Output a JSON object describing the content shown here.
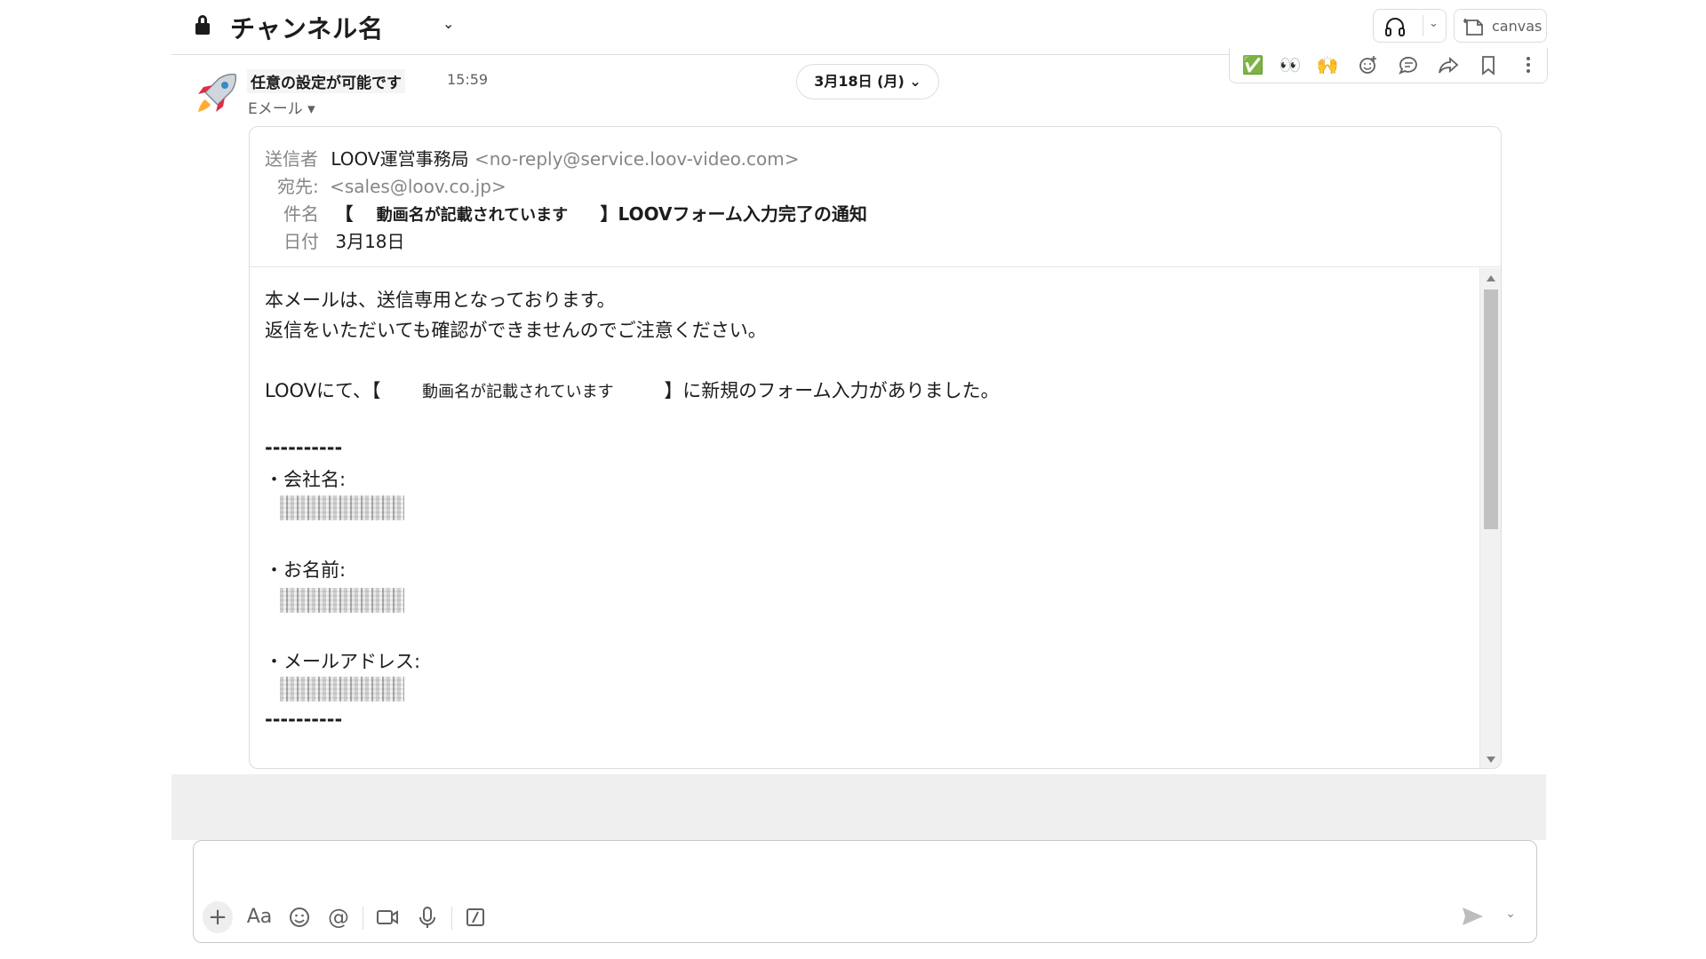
{
  "header": {
    "channel_name": "チャンネル名",
    "canvas_label": "canvas"
  },
  "message": {
    "sender_name": "任意の設定が可能です",
    "time": "15:59",
    "subtitle": "Eメール ▾",
    "date_pill": "3月18日 (月) ⌄",
    "reactions": [
      "✅",
      "👀",
      "🙌"
    ],
    "icons": [
      "headphone-icon",
      "canvas-icon",
      "lock-icon",
      "rocket-icon",
      "add-reaction-icon",
      "reply-thread-icon",
      "share-icon",
      "bookmark-icon",
      "more-icon",
      "plus-icon",
      "formatting-icon",
      "emoji-icon",
      "mention-icon",
      "video-icon",
      "microphone-icon",
      "slash-command-icon",
      "send-icon"
    ]
  },
  "email": {
    "from_label": "送信者",
    "from_name": "LOOV運営事務局",
    "from_address": "<no-reply@service.loov-video.com>",
    "to_label": "宛先:",
    "to_address": "<sales@loov.co.jp>",
    "subject_label": "件名",
    "subject_open": "【",
    "subject_video": "動画名が記載されています",
    "subject_close": "】LOOVフォーム入力完了の通知",
    "date_label": "日付",
    "date_value": "3月18日",
    "body": {
      "line1": "本メールは、送信専用となっております。",
      "line2": "返信をいただいても確認ができませんのでご注意ください。",
      "line3_prefix": "LOOVにて、【",
      "line3_video": "動画名が記載されています",
      "line3_suffix": "】に新規のフォーム入力がありました。",
      "divider": "----------",
      "company_label": "・会社名:",
      "name_label": "・お名前:",
      "email_label": "・メールアドレス:",
      "divider2": "----------"
    }
  },
  "composer": {
    "format_label": "Aa"
  },
  "colors": {
    "accent_text": "#1d1c1d",
    "muted_text": "#868686",
    "border": "#dddddd",
    "band": "#efefef"
  }
}
